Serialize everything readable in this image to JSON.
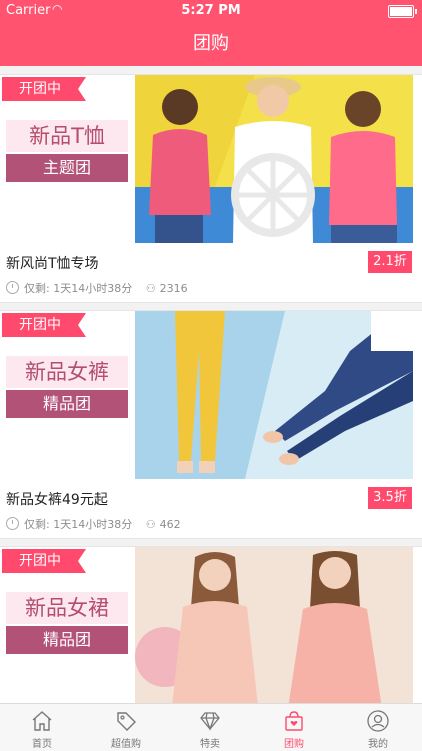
{
  "status": {
    "carrier": "Carrier",
    "time": "5:27 PM"
  },
  "nav": {
    "title": "团购"
  },
  "cards": [
    {
      "badge": "开团中",
      "promo_title": "新品T恤",
      "promo_sub": "主题团",
      "name": "新风尚T恤专场",
      "discount": "2.1折",
      "remaining_label": "仅剩:",
      "remaining_time": "1天14小时38分",
      "count": "2316"
    },
    {
      "badge": "开团中",
      "promo_title": "新品女裤",
      "promo_sub": "精品团",
      "name": "新品女裤49元起",
      "discount": "3.5折",
      "remaining_label": "仅剩:",
      "remaining_time": "1天14小时38分",
      "count": "462"
    },
    {
      "badge": "开团中",
      "promo_title": "新品女裙",
      "promo_sub": "精品团",
      "name": "",
      "discount": "",
      "remaining_label": "",
      "remaining_time": "",
      "count": ""
    }
  ],
  "tabs": [
    {
      "label": "首页",
      "icon": "home-icon"
    },
    {
      "label": "超值购",
      "icon": "tag-icon"
    },
    {
      "label": "特卖",
      "icon": "diamond-icon"
    },
    {
      "label": "团购",
      "icon": "shopping-bag-icon",
      "active": true
    },
    {
      "label": "我的",
      "icon": "user-icon"
    }
  ],
  "colors": {
    "brand": "#ff5370",
    "accent": "#ff4a6d",
    "promo_sub_bg": "#b35277"
  }
}
